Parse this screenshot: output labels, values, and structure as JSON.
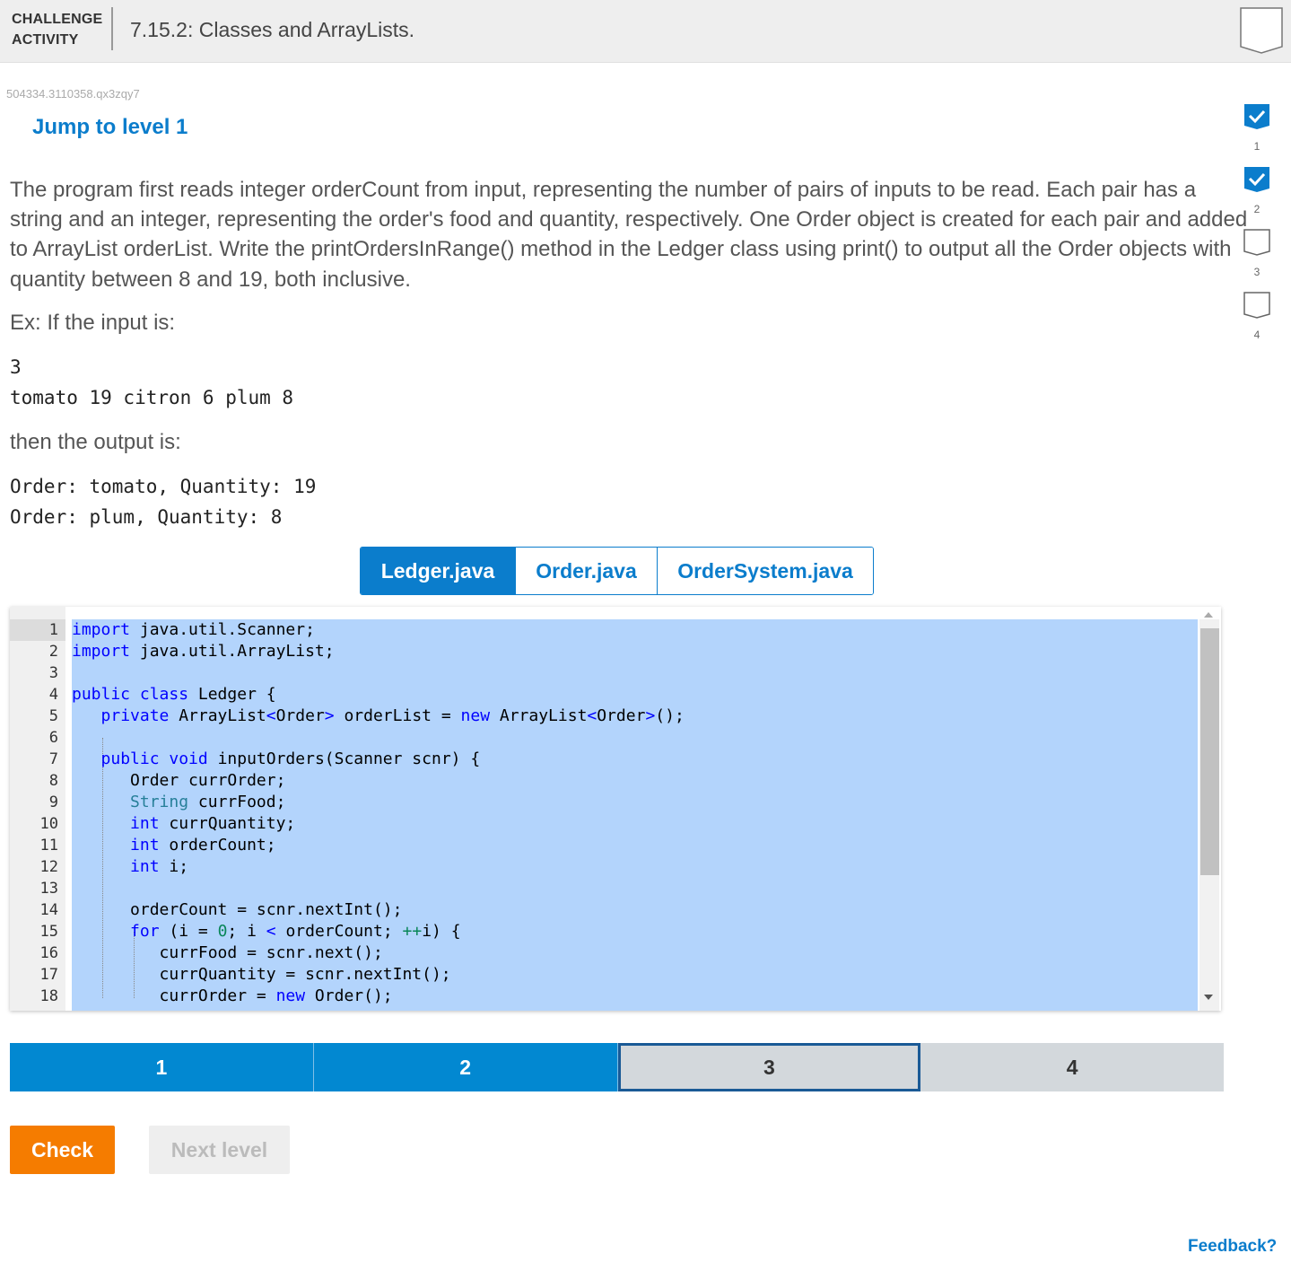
{
  "header": {
    "kind_line1": "CHALLENGE",
    "kind_line2": "ACTIVITY",
    "title": "7.15.2: Classes and ArrayLists."
  },
  "activity_id": "504334.3110358.qx3zqy7",
  "jump_link": "Jump to level 1",
  "level_checks": [
    {
      "num": "1",
      "done": true
    },
    {
      "num": "2",
      "done": true
    },
    {
      "num": "3",
      "done": false
    },
    {
      "num": "4",
      "done": false
    }
  ],
  "description": {
    "line1": "The program first reads integer orderCount from input, representing the number of pairs of inputs to be read. Each pair has a",
    "line2": "string and an integer, representing the order's food and quantity, respectively. One Order object is created for each pair and added",
    "line3": "to ArrayList orderList. Write the printOrdersInRange() method in the Ledger class using print() to output all the Order objects with",
    "line4": "quantity between 8 and 19, both inclusive.",
    "example_intro": "Ex: If the input is:",
    "input_line1": "3",
    "input_line2": "tomato 19 citron 6 plum 8",
    "output_intro": "then the output is:",
    "output_line1": "Order: tomato, Quantity: 19",
    "output_line2": "Order: plum, Quantity: 8"
  },
  "tabs": [
    {
      "label": "Ledger.java",
      "active": true
    },
    {
      "label": "Order.java",
      "active": false
    },
    {
      "label": "OrderSystem.java",
      "active": false
    }
  ],
  "editor": {
    "line_numbers": [
      "1",
      "2",
      "3",
      "4",
      "5",
      "6",
      "7",
      "8",
      "9",
      "10",
      "11",
      "12",
      "13",
      "14",
      "15",
      "16",
      "17",
      "18"
    ]
  },
  "levels": [
    {
      "label": "1",
      "state": "done"
    },
    {
      "label": "2",
      "state": "done"
    },
    {
      "label": "3",
      "state": "current"
    },
    {
      "label": "4",
      "state": "todo"
    }
  ],
  "buttons": {
    "check": "Check",
    "next_level": "Next level"
  },
  "feedback": "Feedback?",
  "colors": {
    "accent": "#0b7dcc",
    "check_button": "#f57c00",
    "selection": "#b3d4fc"
  }
}
